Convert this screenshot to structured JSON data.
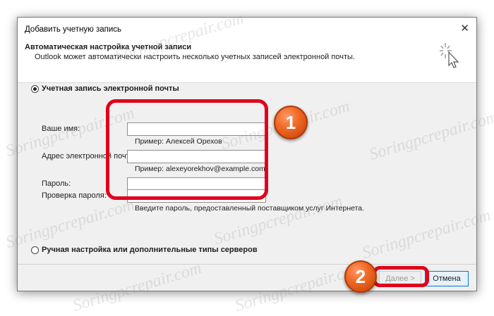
{
  "window": {
    "title": "Добавить учетную запись"
  },
  "header": {
    "title": "Автоматическая настройка учетной записи",
    "subtitle": "Outlook может автоматически настроить несколько учетных записей электронной почты.",
    "icon": "cursor-sparkle-icon"
  },
  "options": {
    "email_account_label": "Учетная запись электронной почты",
    "manual_label": "Ручная настройка или дополнительные типы серверов",
    "selected": "email_account"
  },
  "form": {
    "name_label": "Ваше имя:",
    "name_value": "",
    "name_hint": "Пример: Алексей Орехов",
    "email_label": "Адрес электронной почты:",
    "email_value": "",
    "email_hint": "Пример: alexeyorekhov@example.com",
    "password_label": "Пароль:",
    "password_value": "",
    "confirm_label": "Проверка пароля:",
    "confirm_value": "",
    "password_hint": "Введите пароль, предоставленный поставщиком услуг Интернета."
  },
  "buttons": {
    "next_label": "Далее >",
    "cancel_label": "Отмена"
  },
  "annotations": {
    "badge1": "1",
    "badge2": "2",
    "highlight_color": "#e0001b",
    "badge_color": "#f06a26"
  },
  "watermark": {
    "text": "Soringpcrepair.com"
  }
}
